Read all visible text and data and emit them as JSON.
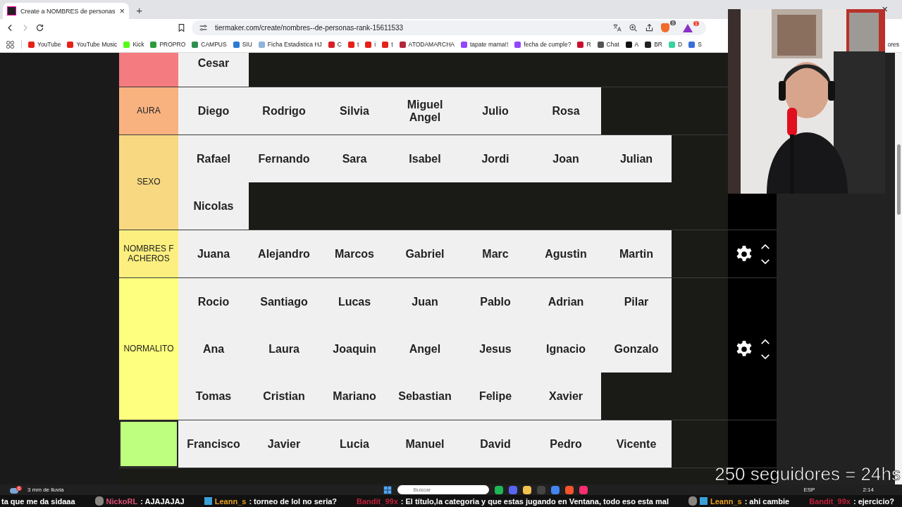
{
  "browser": {
    "tab": {
      "title": "Create a NOMBRES de personas",
      "close": "×"
    },
    "new_tab": "+",
    "window_close": "×",
    "address": "tiermaker.com/create/nombres--de-personas-rank-15611533",
    "badges": [
      "6",
      "1"
    ],
    "bookmarks": [
      {
        "label": "YouTube",
        "color": "#e62117"
      },
      {
        "label": "YouTube Music",
        "color": "#e62117"
      },
      {
        "label": "Kick",
        "color": "#53fc18"
      },
      {
        "label": "PROPRO",
        "color": "#2e9b3a"
      },
      {
        "label": "CAMPUS",
        "color": "#2f8f4e"
      },
      {
        "label": "SIU",
        "color": "#2b7bd6"
      },
      {
        "label": "Ficha Estadistica HJ",
        "color": "#8fb3d9"
      },
      {
        "label": "C",
        "color": "#d81f26"
      },
      {
        "label": "t",
        "color": "#e62117"
      },
      {
        "label": "i",
        "color": "#e62117"
      },
      {
        "label": "t",
        "color": "#e62117"
      },
      {
        "label": "ATODAMARCHA",
        "color": "#b0283a"
      },
      {
        "label": "tapate mama!!",
        "color": "#9146ff"
      },
      {
        "label": "fecha de cumple?",
        "color": "#9146ff"
      },
      {
        "label": "R",
        "color": "#c8102e"
      },
      {
        "label": "Chat",
        "color": "#555555"
      },
      {
        "label": "A",
        "color": "#111111"
      },
      {
        "label": "BR",
        "color": "#222222"
      },
      {
        "label": "D",
        "color": "#3ad29f"
      },
      {
        "label": "S",
        "color": "#3b6fd8"
      }
    ],
    "bookmarks_more": "ores"
  },
  "tiers": [
    {
      "color": "#f47b7f",
      "selected": false,
      "items": [
        "Cesar"
      ]
    },
    {
      "label": "AURA",
      "color": "#f7b27f",
      "selected": false,
      "items": [
        "Diego",
        "Rodrigo",
        "Silvia",
        "Miguel Angel",
        "Julio",
        "Rosa"
      ]
    },
    {
      "label": "SEXO",
      "color": "#f8d880",
      "selected": false,
      "items": [
        "Rafael",
        "Fernando",
        "Sara",
        "Isabel",
        "Jordi",
        "Joan",
        "Julian",
        "Nicolas"
      ]
    },
    {
      "label": "NOMBRES FACHEROS",
      "color": "#fcef7f",
      "selected": false,
      "items": [
        "Juana",
        "Alejandro",
        "Marcos",
        "Gabriel",
        "Marc",
        "Agustin",
        "Martin"
      ]
    },
    {
      "label": "NORMALITO",
      "color": "#fefe7f",
      "selected": false,
      "items": [
        "Rocio",
        "Santiago",
        "Lucas",
        "Juan",
        "Pablo",
        "Adrian",
        "Pilar",
        "Ana",
        "Laura",
        "Joaquin",
        "Angel",
        "Jesus",
        "Ignacio",
        "Gonzalo",
        "Tomas",
        "Cristian",
        "Mariano",
        "Sebastian",
        "Felipe",
        "Xavier"
      ]
    },
    {
      "color": "#bfff7f",
      "selected": true,
      "items": [
        "Francisco",
        "Javier",
        "Lucia",
        "Manuel",
        "David",
        "Pedro",
        "Vicente"
      ]
    }
  ],
  "overlay": "250 seguidores = 24hs",
  "taskbar": {
    "weather": "3 mm de lluvia",
    "weather_badge": "6",
    "search": "Buscar",
    "language": "ESP",
    "time": "2:14"
  },
  "chat": [
    {
      "kind": "plain",
      "text": "ta que me da sidaaa"
    },
    {
      "kind": "emote",
      "user": "NickoRL",
      "color": "#e0507a",
      "text": ": AJAJAJAJ"
    },
    {
      "kind": "badge",
      "user": "Leann_s",
      "color": "#e8a020",
      "text": ": torneo de lol no seria?"
    },
    {
      "kind": "plain",
      "user": "Bandit_99x",
      "color": "#c0203a",
      "text": ": El título,la categoria y que estas jugando en Ventana, todo eso esta mal"
    },
    {
      "kind": "both",
      "user": "Leann_s",
      "color": "#e8a020",
      "text": ": ahi cambie"
    },
    {
      "kind": "plain",
      "user": "Bandit_99x",
      "color": "#c0203a",
      "text": ": ejercicio?"
    }
  ]
}
